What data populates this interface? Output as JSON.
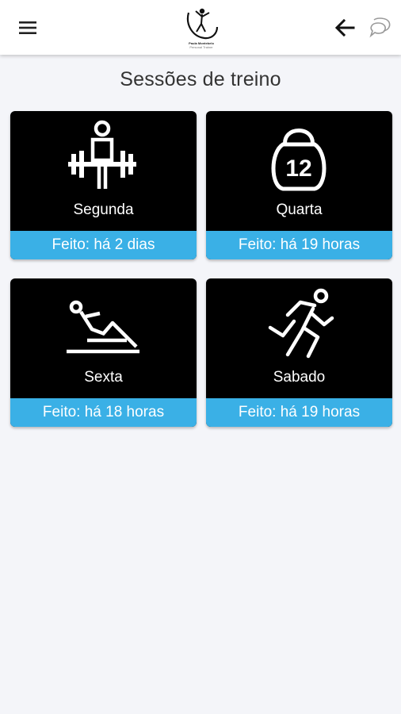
{
  "header": {
    "menu_icon": "hamburger-menu-icon",
    "logo_icon": "gymnast-logo",
    "logo_line1": "Paula Montebelo",
    "logo_line2": "Personal Trainer",
    "back_icon": "arrow-left-icon",
    "chat_icon": "chat-bubbles-icon"
  },
  "page": {
    "title": "Sessões de treino"
  },
  "sessions": [
    {
      "day": "Segunda",
      "status": "Feito: há 2 dias",
      "icon": "weightlifter-icon"
    },
    {
      "day": "Quarta",
      "status": "Feito: há 19 horas",
      "icon": "kettlebell-12-icon"
    },
    {
      "day": "Sexta",
      "status": "Feito: há 18 horas",
      "icon": "situp-exercise-icon"
    },
    {
      "day": "Sabado",
      "status": "Feito: há 19 horas",
      "icon": "runner-icon"
    }
  ],
  "kettlebell_number": "12",
  "colors": {
    "accent": "#3ab0e6",
    "card_bg": "#000000",
    "page_bg": "#f4f5f9"
  }
}
